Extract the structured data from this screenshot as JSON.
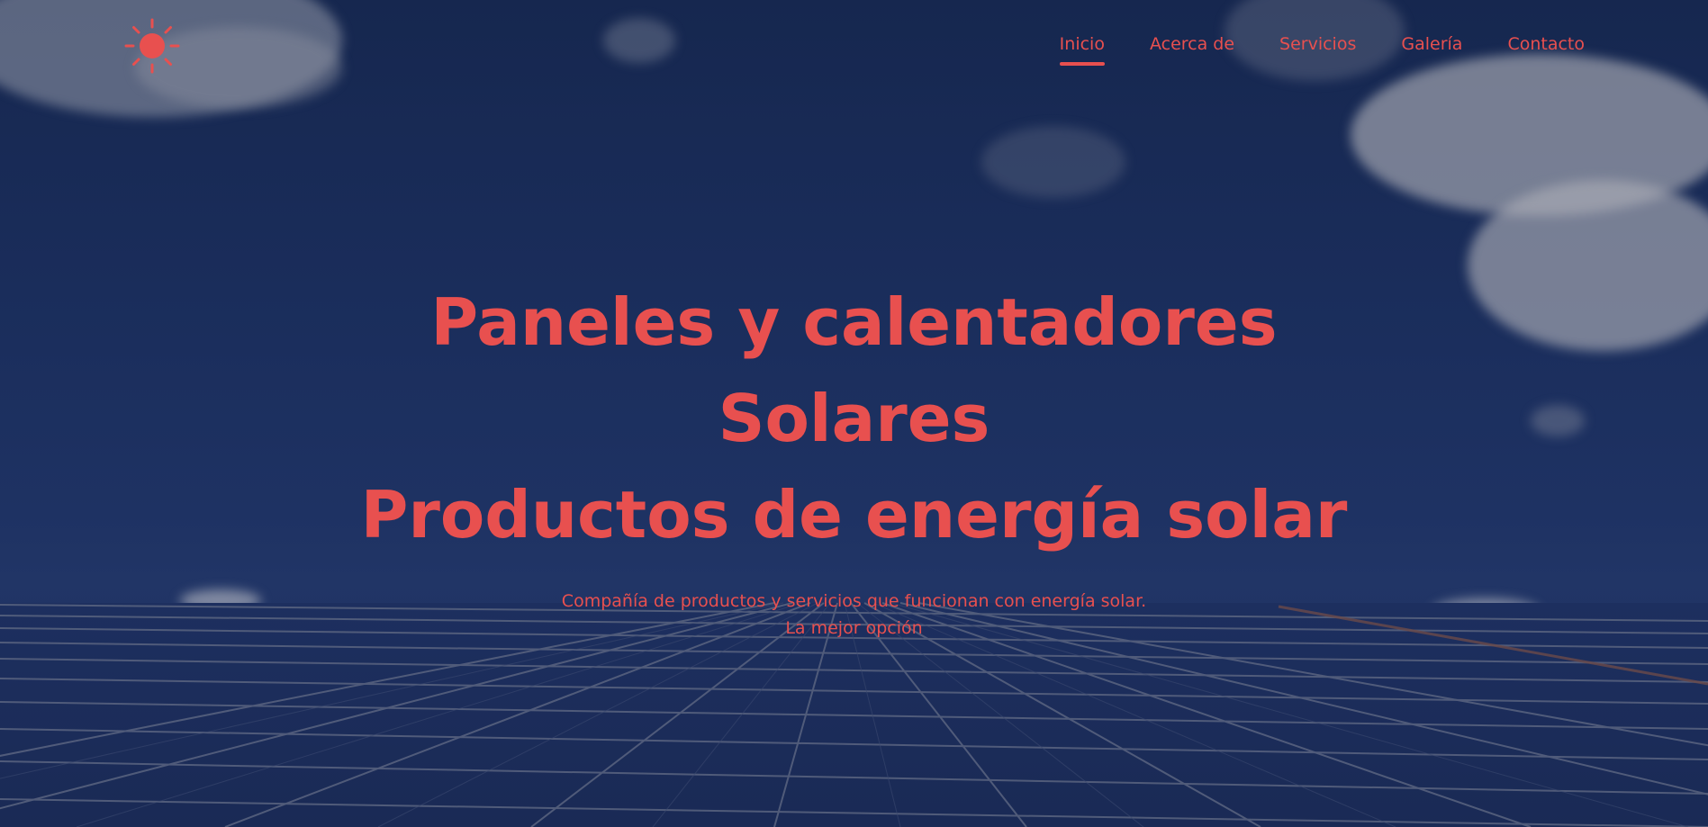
{
  "nav": {
    "items": [
      {
        "label": "Inicio",
        "active": true
      },
      {
        "label": "Acerca de",
        "active": false
      },
      {
        "label": "Servicios",
        "active": false
      },
      {
        "label": "Galería",
        "active": false
      },
      {
        "label": "Contacto",
        "active": false
      }
    ]
  },
  "logo": {
    "icon": "sun-icon"
  },
  "hero": {
    "title_line1": "Paneles y calentadores",
    "title_line2": "Solares",
    "title_line3": "Productos de energía solar",
    "subtitle_line1": "Compañía de productos y servicios que funcionan con energía solar.",
    "subtitle_line2": "La mejor opción"
  },
  "colors": {
    "accent": "#e8504f",
    "background": "#1b2d5c"
  }
}
